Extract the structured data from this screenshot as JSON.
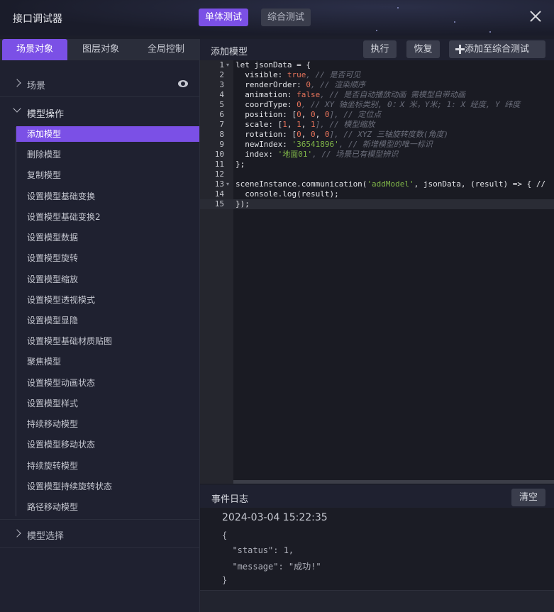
{
  "window": {
    "title": "接口调试器",
    "mode_tabs": [
      "单体测试",
      "综合测试"
    ]
  },
  "left_tabs": [
    "场景对象",
    "图层对象",
    "全局控制"
  ],
  "sidebar": {
    "groups": [
      "场景",
      "模型操作",
      "模型选择"
    ],
    "items": [
      "添加模型",
      "删除模型",
      "复制模型",
      "设置模型基础变换",
      "设置模型基础变换2",
      "设置模型数据",
      "设置模型旋转",
      "设置模型缩放",
      "设置模型透视模式",
      "设置模型显隐",
      "设置模型基础材质贴图",
      "聚焦模型",
      "设置模型动画状态",
      "设置模型样式",
      "持续移动模型",
      "设置模型移动状态",
      "持续旋转模型",
      "设置模型持续旋转状态",
      "路径移动模型"
    ],
    "active_item": "添加模型"
  },
  "editor": {
    "panel_title": "添加模型",
    "buttons": {
      "execute": "执行",
      "restore": "恢复",
      "add_to_combined": "添加至综合测试"
    },
    "line_numbers": [
      "1",
      "2",
      "3",
      "4",
      "5",
      "6",
      "7",
      "8",
      "9",
      "10",
      "11",
      "12",
      "13",
      "14",
      "15"
    ],
    "code": {
      "l1_kw": "let",
      "l1_rest": " jsonData = {",
      "l2_key": "  visible: ",
      "l2_val": "true",
      "l2_comment": ", // 是否可见",
      "l3_key": "  renderOrder: ",
      "l3_val": "0",
      "l3_comment": ", // 渲染顺序",
      "l4_key": "  animation: ",
      "l4_val": "false",
      "l4_comment": ", // 是否自动播放动画 需模型自带动画",
      "l5_key": "  coordType: ",
      "l5_val": "0",
      "l5_comment": ", // XY 轴坐标类别, 0：X 米，Y米; 1: X 经度, Y 纬度",
      "l6_key": "  position: [",
      "l6_vals": [
        "0",
        "0",
        "0"
      ],
      "l6_comment": "], // 定位点",
      "l7_key": "  scale: [",
      "l7_vals": [
        "1",
        "1",
        "1"
      ],
      "l7_comment": "], // 模型缩放",
      "l8_key": "  rotation: [",
      "l8_vals": [
        "0",
        "0",
        "0"
      ],
      "l8_comment": "], // XYZ 三轴旋转度数(角度)",
      "l9_key": "  newIndex: ",
      "l9_val": "'36541896'",
      "l9_comment": ", // 新增模型的唯一标识",
      "l10_key": "  index: ",
      "l10_val": "'地面01'",
      "l10_comment": ", // 场景已有模型辨识",
      "l11": "};",
      "l13_pre": "sceneInstance.communication(",
      "l13_str": "'addModel'",
      "l13_post": ", jsonData, (result) => { // ",
      "l14": "  console.log(result);",
      "l15": "});"
    }
  },
  "event_log": {
    "title": "事件日志",
    "clear_label": "清空",
    "timestamp": "2024-03-04 15:22:35",
    "lines": [
      "{",
      "  \"status\": 1,",
      "  \"message\": \"成功!\"",
      "}"
    ]
  }
}
